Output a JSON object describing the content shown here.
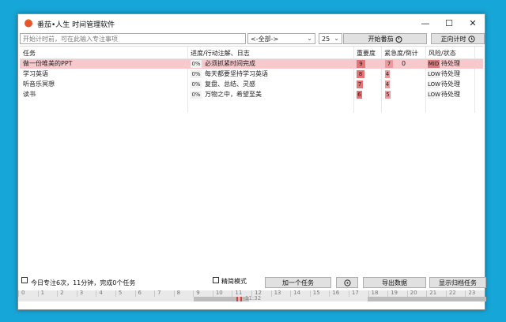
{
  "window": {
    "title": "番茄•人生 时间管理软件",
    "controls": {
      "minimize": "—",
      "maximize": "☐",
      "close": "✕"
    }
  },
  "toolbar": {
    "search_placeholder": "开始计时前，可在此输入专注事项",
    "search_value": "",
    "category_select": "<-全部->",
    "count_select": "25",
    "start_button": "开始番茄",
    "forward_button": "正向计时"
  },
  "table": {
    "columns": {
      "task": "任务",
      "progress": "进度/行动注解、日志",
      "importance": "重要度",
      "urgency": "紧急度/倒计",
      "risk": "风险/状态"
    },
    "rows": [
      {
        "task": "做一份唯美的PPT",
        "progress": "0%",
        "note": "必须抓紧时间完成",
        "importance": "9",
        "urgency": "7",
        "countdown": "0",
        "risk": "MID",
        "status": "待处理",
        "highlight": true,
        "importance_level": 0.9,
        "urgency_level": 0.7
      },
      {
        "task": "学习英语",
        "progress": "0%",
        "note": "每天都要坚持学习英语",
        "importance": "8",
        "urgency": "4",
        "countdown": "",
        "risk": "LOW",
        "status": "待处理",
        "highlight": false,
        "importance_level": 0.8,
        "urgency_level": 0.4
      },
      {
        "task": "听音乐冥想",
        "progress": "0%",
        "note": "复盘、总结、灵感",
        "importance": "7",
        "urgency": "4",
        "countdown": "",
        "risk": "LOW",
        "status": "待处理",
        "highlight": false,
        "importance_level": 0.7,
        "urgency_level": 0.4
      },
      {
        "task": "读书",
        "progress": "0%",
        "note": "万物之中，希望至美",
        "importance": "6",
        "urgency": "5",
        "countdown": "",
        "risk": "LOW",
        "status": "待处理",
        "highlight": false,
        "importance_level": 0.6,
        "urgency_level": 0.5
      }
    ]
  },
  "status_bar": {
    "summary": "今日专注6次，11分钟，完成0个任务",
    "quiet_mode": "精简模式",
    "add_task": "加一个任务",
    "export": "导出数据",
    "show_archive": "显示归档任务"
  },
  "timeline": {
    "hours": [
      "0",
      "1",
      "2",
      "3",
      "4",
      "5",
      "6",
      "7",
      "8",
      "9",
      "10",
      "11",
      "12",
      "13",
      "14",
      "15",
      "16",
      "17",
      "18",
      "19",
      "20",
      "21",
      "22",
      "23"
    ],
    "now_label": "11:32"
  },
  "colors": {
    "desktop": "#17a6d8",
    "highlight_row": "#f8c9cc",
    "importance_bar": "#e47476",
    "urgency_bar": "#ee9a9d"
  }
}
